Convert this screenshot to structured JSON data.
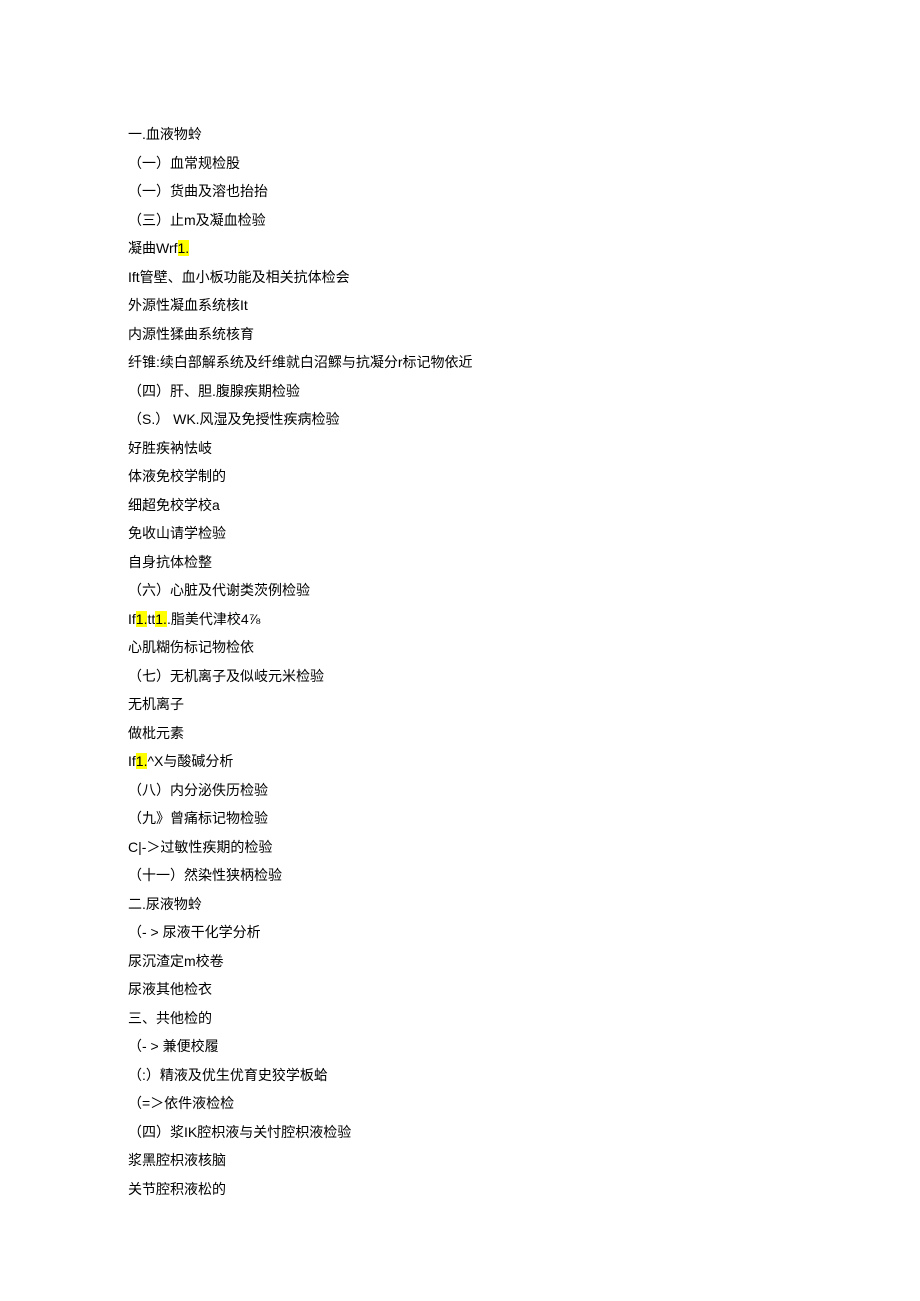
{
  "lines": [
    {
      "segments": [
        {
          "text": "一.血液物蛉"
        }
      ]
    },
    {
      "segments": [
        {
          "text": "（一）血常规检股"
        }
      ]
    },
    {
      "segments": [
        {
          "text": "（一）货曲及溶也抬抬"
        }
      ]
    },
    {
      "segments": [
        {
          "text": "（三）止m及凝血检验"
        }
      ]
    },
    {
      "segments": [
        {
          "text": "凝曲Wrf"
        },
        {
          "text": "1.",
          "highlight": true
        }
      ]
    },
    {
      "segments": [
        {
          "text": "Ift管壁、血小板功能及相关抗体检会"
        }
      ]
    },
    {
      "segments": [
        {
          "text": "外源性凝血系统核It"
        }
      ]
    },
    {
      "segments": [
        {
          "text": "内源性猱曲系统核育"
        }
      ]
    },
    {
      "segments": [
        {
          "text": "纤锥:续白部解系统及纤维就白沼鰥与抗凝分r标记物依近"
        }
      ]
    },
    {
      "segments": [
        {
          "text": "（四）肝、胆.腹腺疾期检验"
        }
      ]
    },
    {
      "segments": [
        {
          "text": "（S.） WK.风湿及免授性疾病检验"
        }
      ]
    },
    {
      "segments": [
        {
          "text": "好胜疾衲怯岐"
        }
      ]
    },
    {
      "segments": [
        {
          "text": "体液免校学制的"
        }
      ]
    },
    {
      "segments": [
        {
          "text": "细超免校学校a"
        }
      ]
    },
    {
      "segments": [
        {
          "text": "免收山请学检验"
        }
      ]
    },
    {
      "segments": [
        {
          "text": "自身抗体检整"
        }
      ]
    },
    {
      "segments": [
        {
          "text": "（六）心脏及代谢类茨例检验"
        }
      ]
    },
    {
      "segments": [
        {
          "text": "If"
        },
        {
          "text": "1.",
          "highlight": true
        },
        {
          "text": "tt"
        },
        {
          "text": "1.",
          "highlight": true
        },
        {
          "text": ".脂美代津校4⅞"
        }
      ]
    },
    {
      "segments": [
        {
          "text": "心肌糊伤标记物检依"
        }
      ]
    },
    {
      "segments": [
        {
          "text": "（七）无机离子及似岐元米检验"
        }
      ]
    },
    {
      "segments": [
        {
          "text": "无机离子"
        }
      ]
    },
    {
      "segments": [
        {
          "text": "做枇元素"
        }
      ]
    },
    {
      "segments": [
        {
          "text": "If"
        },
        {
          "text": "1.",
          "highlight": true
        },
        {
          "text": "^X与酸碱分析"
        }
      ]
    },
    {
      "segments": [
        {
          "text": "（八）内分泌佚历检验"
        }
      ]
    },
    {
      "segments": [
        {
          "text": "（九》曾痛标记物检验"
        }
      ]
    },
    {
      "segments": [
        {
          "text": "C|-＞过敏性疾期的检验"
        }
      ]
    },
    {
      "segments": [
        {
          "text": "（十一）然染性狭柄检验"
        }
      ]
    },
    {
      "segments": [
        {
          "text": "二.尿液物蛉"
        }
      ]
    },
    {
      "segments": [
        {
          "text": "（- > 尿液干化学分析"
        }
      ]
    },
    {
      "segments": [
        {
          "text": "尿沉渣定m校卷"
        }
      ]
    },
    {
      "segments": [
        {
          "text": "尿液其他检衣"
        }
      ]
    },
    {
      "segments": [
        {
          "text": "三、共他检的"
        }
      ]
    },
    {
      "segments": [
        {
          "text": "（- > 兼便校履"
        }
      ]
    },
    {
      "segments": [
        {
          "text": "（:）精液及优生优育史狡学板蛤"
        }
      ]
    },
    {
      "segments": [
        {
          "text": " （=＞依件液检检"
        }
      ]
    },
    {
      "segments": [
        {
          "text": "（四）浆IK腔枳液与关忖腔枳液检验"
        }
      ]
    },
    {
      "segments": [
        {
          "text": "浆黑腔枳液核脑"
        }
      ]
    },
    {
      "segments": [
        {
          "text": "关节腔积液松的"
        }
      ]
    }
  ]
}
